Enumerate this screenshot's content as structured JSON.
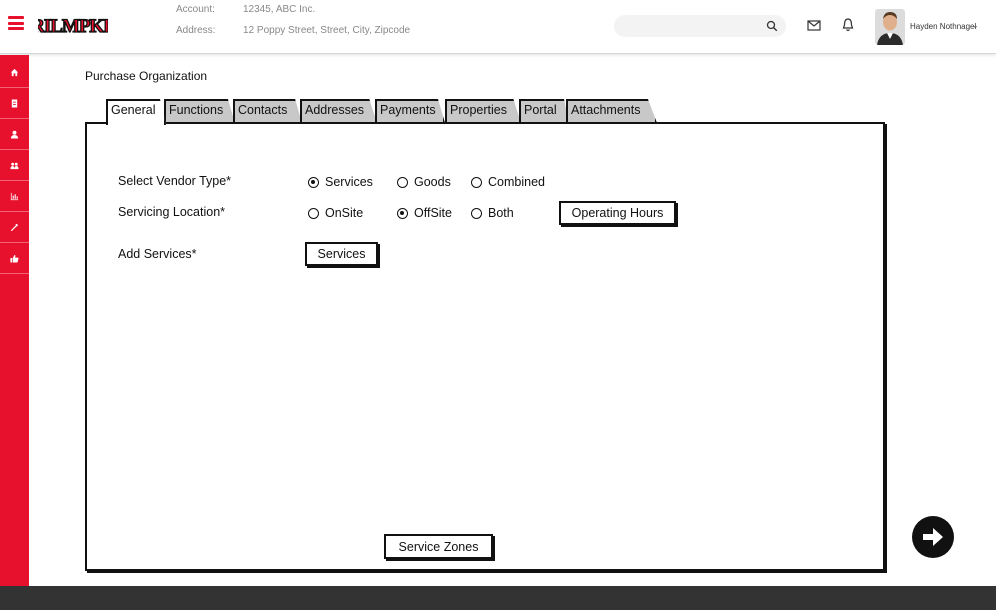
{
  "header": {
    "logo_text": "RILMPKE",
    "account_label": "Account:",
    "account_value": "12345, ABC Inc.",
    "address_label": "Address:",
    "address_value": "12 Poppy Street, Street, City, Zipcode",
    "search_placeholder": "",
    "user_name": "Hayden Nothnagel",
    "brand_color": "#e8112d"
  },
  "sidebar": {
    "items": [
      {
        "icon": "home-icon"
      },
      {
        "icon": "document-icon"
      },
      {
        "icon": "user-icon"
      },
      {
        "icon": "group-icon"
      },
      {
        "icon": "chart-icon"
      },
      {
        "icon": "tools-icon"
      },
      {
        "icon": "thumbs-up-icon"
      }
    ]
  },
  "page": {
    "title": "Purchase Organization"
  },
  "tabs": [
    {
      "label": "General",
      "active": true
    },
    {
      "label": "Functions"
    },
    {
      "label": "Contacts"
    },
    {
      "label": "Addresses"
    },
    {
      "label": "Payments"
    },
    {
      "label": "Properties"
    },
    {
      "label": "Portal"
    },
    {
      "label": "Attachments"
    }
  ],
  "form": {
    "vendor_type_label": "Select Vendor Type*",
    "vendor_type_options": [
      "Services",
      "Goods",
      "Combined"
    ],
    "vendor_type_selected": "Services",
    "location_label": "Servicing Location*",
    "location_options": [
      "OnSite",
      "OffSite",
      "Both"
    ],
    "location_selected": "OffSite",
    "operating_hours_button": "Operating Hours",
    "add_services_label": "Add Services*",
    "services_button": "Services",
    "service_zones_button": "Service Zones"
  }
}
